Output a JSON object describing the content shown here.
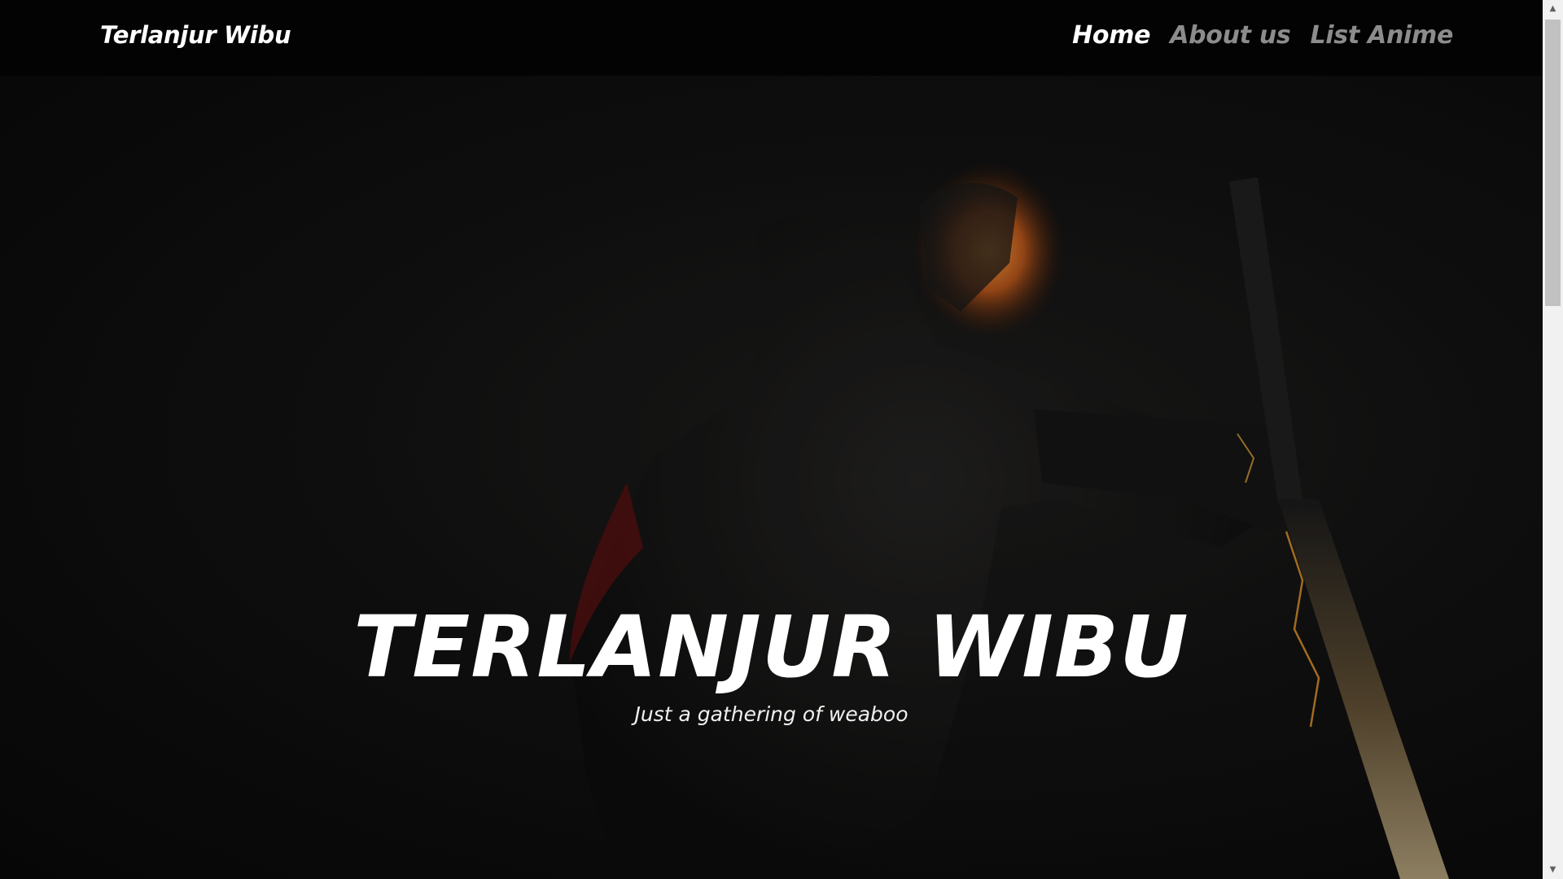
{
  "navbar": {
    "brand": "Terlanjur Wibu",
    "links": [
      {
        "label": "Home",
        "active": true
      },
      {
        "label": "About us",
        "active": false
      },
      {
        "label": "List Anime",
        "active": false
      }
    ]
  },
  "hero": {
    "title": "TERLANJUR WIBU",
    "subtitle": "Just a gathering of weaboo",
    "background_image": "armored-swordsman-artwork"
  },
  "colors": {
    "navbar_bg": "#030303",
    "active_link": "#ffffff",
    "inactive_link": "#8c8c8c",
    "hero_glow": "#e07a25"
  },
  "scrollbar": {
    "up_icon": "scroll-up-arrow",
    "down_icon": "scroll-down-arrow"
  }
}
